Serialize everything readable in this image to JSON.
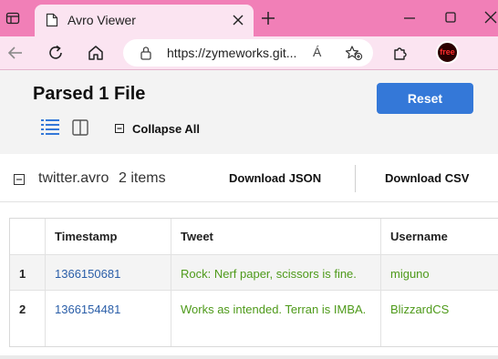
{
  "browser": {
    "tab_title": "Avro Viewer",
    "url": "https://zymeworks.git...",
    "read_aloud": "Á",
    "profile_label": "free",
    "theme_color": "#f17fb7"
  },
  "app": {
    "title": "Parsed 1 File",
    "reset_label": "Reset",
    "collapse_all_label": "Collapse All",
    "accent_color": "#3478d8"
  },
  "file": {
    "name": "twitter.avro",
    "count": "2 items",
    "download_json_label": "Download JSON",
    "download_csv_label": "Download CSV"
  },
  "table": {
    "headers": [
      "",
      "Timestamp",
      "Tweet",
      "Username"
    ],
    "rows": [
      {
        "index": "1",
        "timestamp": "1366150681",
        "tweet": "Rock: Nerf paper, scissors is fine.",
        "username": "miguno"
      },
      {
        "index": "2",
        "timestamp": "1366154481",
        "tweet": "Works as intended. Terran is IMBA.",
        "username": "BlizzardCS"
      }
    ]
  }
}
